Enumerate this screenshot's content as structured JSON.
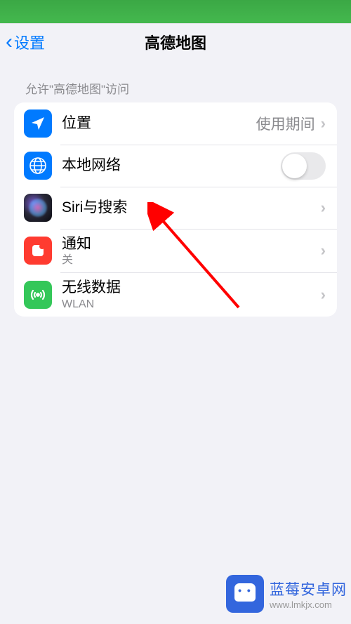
{
  "nav": {
    "back_label": "设置",
    "title": "高德地图"
  },
  "section_header": "允许\"高德地图\"访问",
  "rows": {
    "location": {
      "title": "位置",
      "value": "使用期间"
    },
    "local_network": {
      "title": "本地网络"
    },
    "siri": {
      "title": "Siri与搜索"
    },
    "notification": {
      "title": "通知",
      "subtitle": "关"
    },
    "wireless": {
      "title": "无线数据",
      "subtitle": "WLAN"
    }
  },
  "watermark": {
    "title": "蓝莓安卓网",
    "url": "www.lmkjx.com"
  }
}
